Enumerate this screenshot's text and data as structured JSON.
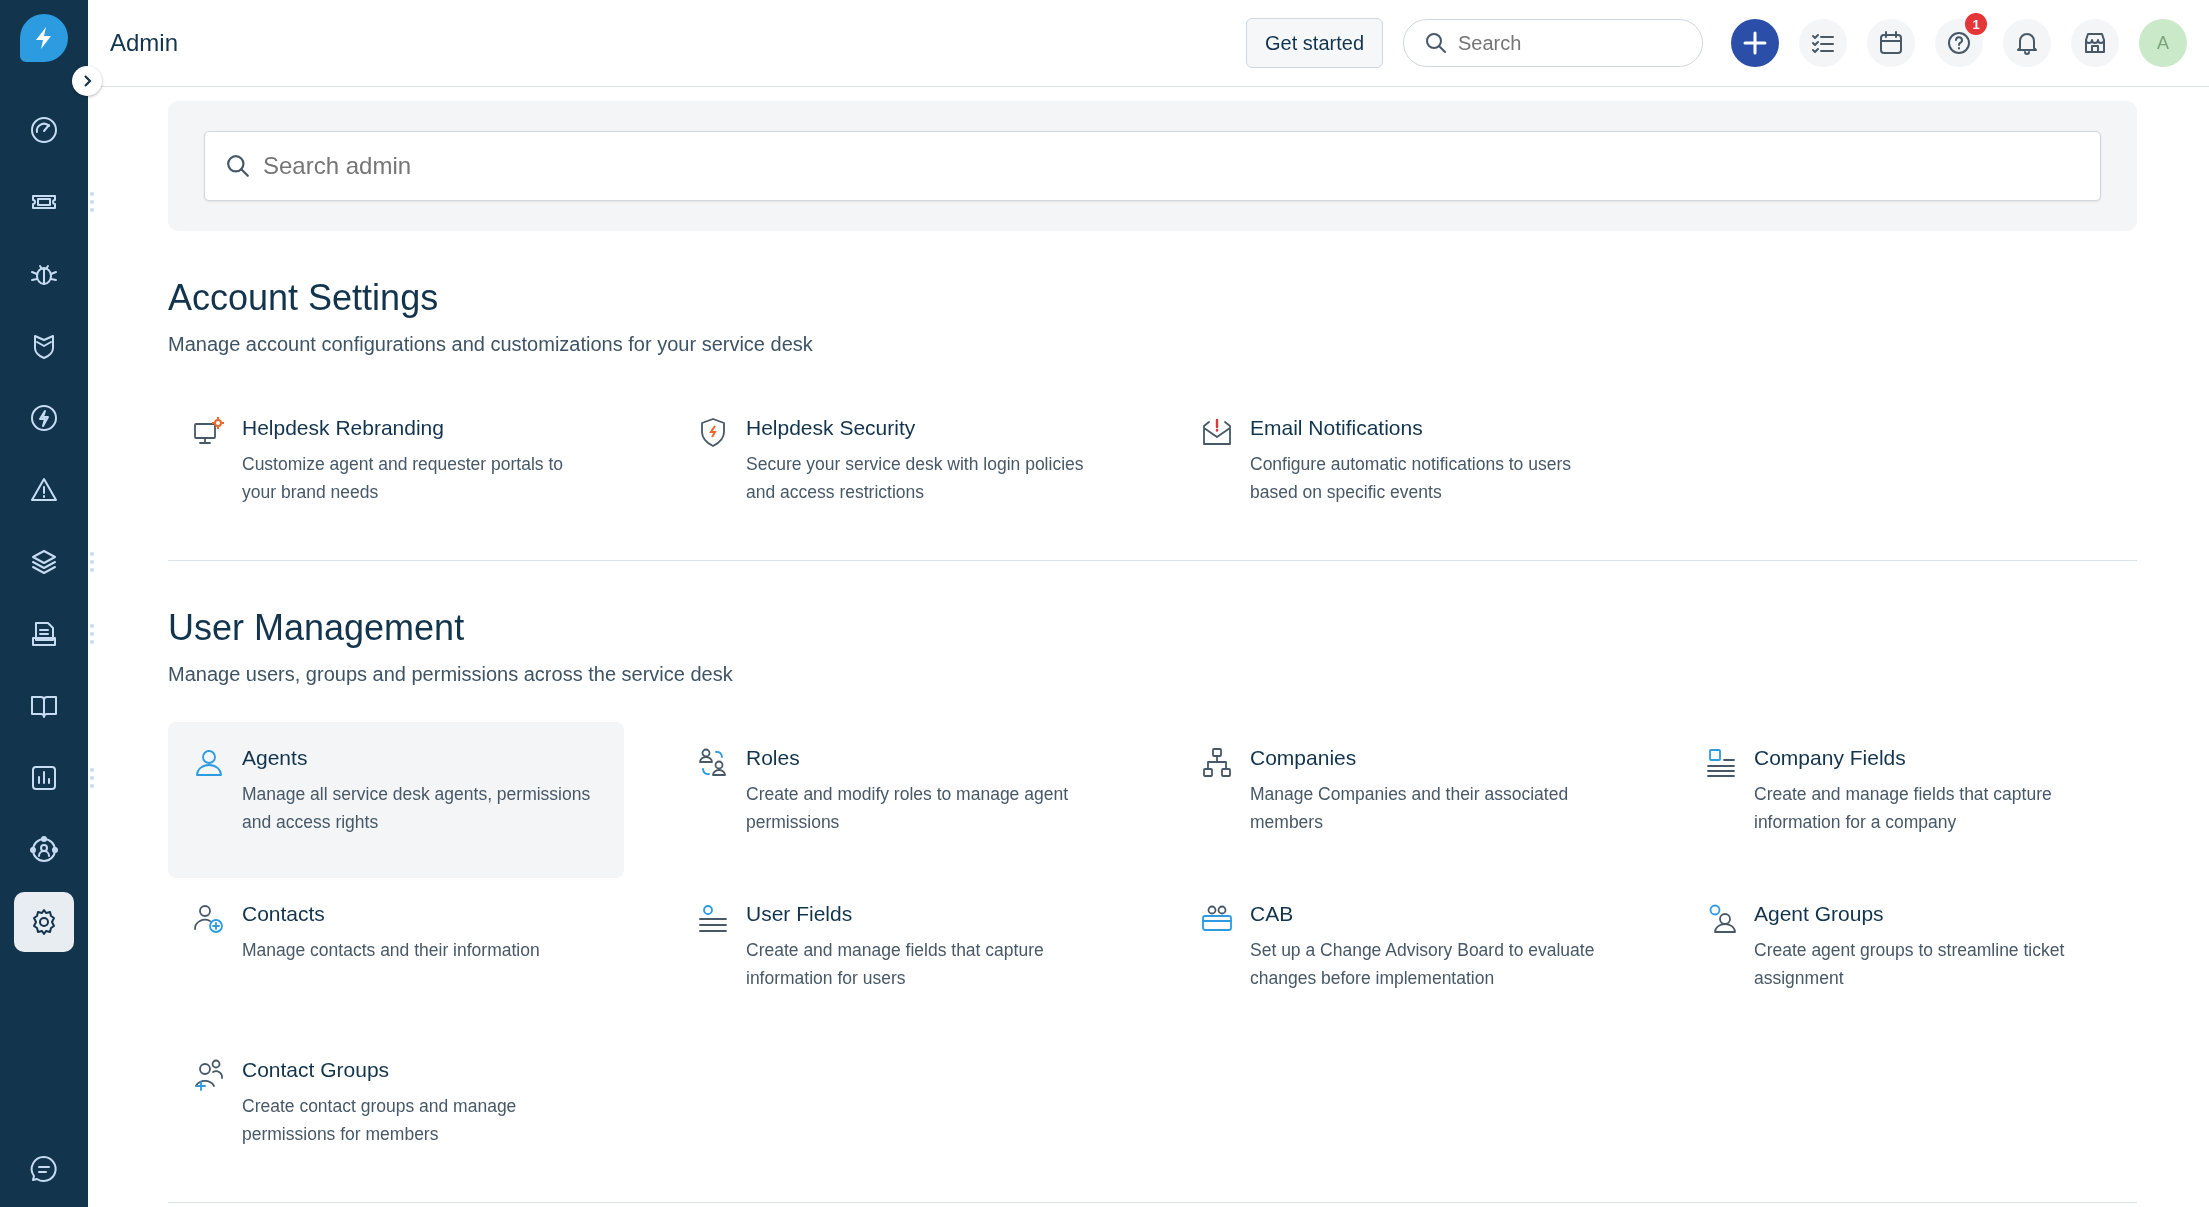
{
  "sidebar": {
    "items": [
      {
        "selected": false,
        "has_menu": false
      },
      {
        "selected": false,
        "has_menu": true
      },
      {
        "selected": false,
        "has_menu": false
      },
      {
        "selected": false,
        "has_menu": false
      },
      {
        "selected": false,
        "has_menu": false
      },
      {
        "selected": false,
        "has_menu": false
      },
      {
        "selected": false,
        "has_menu": true
      },
      {
        "selected": false,
        "has_menu": true
      },
      {
        "selected": false,
        "has_menu": false
      },
      {
        "selected": false,
        "has_menu": true
      },
      {
        "selected": false,
        "has_menu": false
      },
      {
        "selected": true,
        "has_menu": false
      }
    ]
  },
  "header": {
    "title": "Admin",
    "get_started": "Get started",
    "search": {
      "placeholder": "Search"
    },
    "help_badge": "1",
    "avatar": "A"
  },
  "admin_search": {
    "placeholder": "Search admin"
  },
  "sections": [
    {
      "title": "Account Settings",
      "subtitle": "Manage account configurations and customizations for your service desk",
      "items": [
        {
          "title": "Helpdesk Rebranding",
          "description": "Customize agent and requester portals to your brand needs",
          "highlighted": false
        },
        {
          "title": "Helpdesk Security",
          "description": "Secure your service desk with login policies and access restrictions",
          "highlighted": false
        },
        {
          "title": "Email Notifications",
          "description": "Configure automatic notifications to users based on specific events",
          "highlighted": false
        }
      ]
    },
    {
      "title": "User Management",
      "subtitle": "Manage users, groups and permissions across the service desk",
      "items": [
        {
          "title": "Agents",
          "description": "Manage all service desk agents, permissions and access rights",
          "highlighted": true
        },
        {
          "title": "Roles",
          "description": "Create and modify roles to manage agent permissions",
          "highlighted": false
        },
        {
          "title": "Companies",
          "description": "Manage Companies and their associated members",
          "highlighted": false
        },
        {
          "title": "Company Fields",
          "description": "Create and manage fields that capture information for a company",
          "highlighted": false
        },
        {
          "title": "Contacts",
          "description": "Manage contacts and their information",
          "highlighted": false
        },
        {
          "title": "User Fields",
          "description": "Create and manage fields that capture information for users",
          "highlighted": false
        },
        {
          "title": "CAB",
          "description": "Set up a Change Advisory Board to evaluate changes before implementation",
          "highlighted": false
        },
        {
          "title": "Agent Groups",
          "description": "Create agent groups to streamline ticket assignment",
          "highlighted": false
        },
        {
          "title": "Contact Groups",
          "description": "Create contact groups and manage permissions for members",
          "highlighted": false
        }
      ]
    }
  ]
}
